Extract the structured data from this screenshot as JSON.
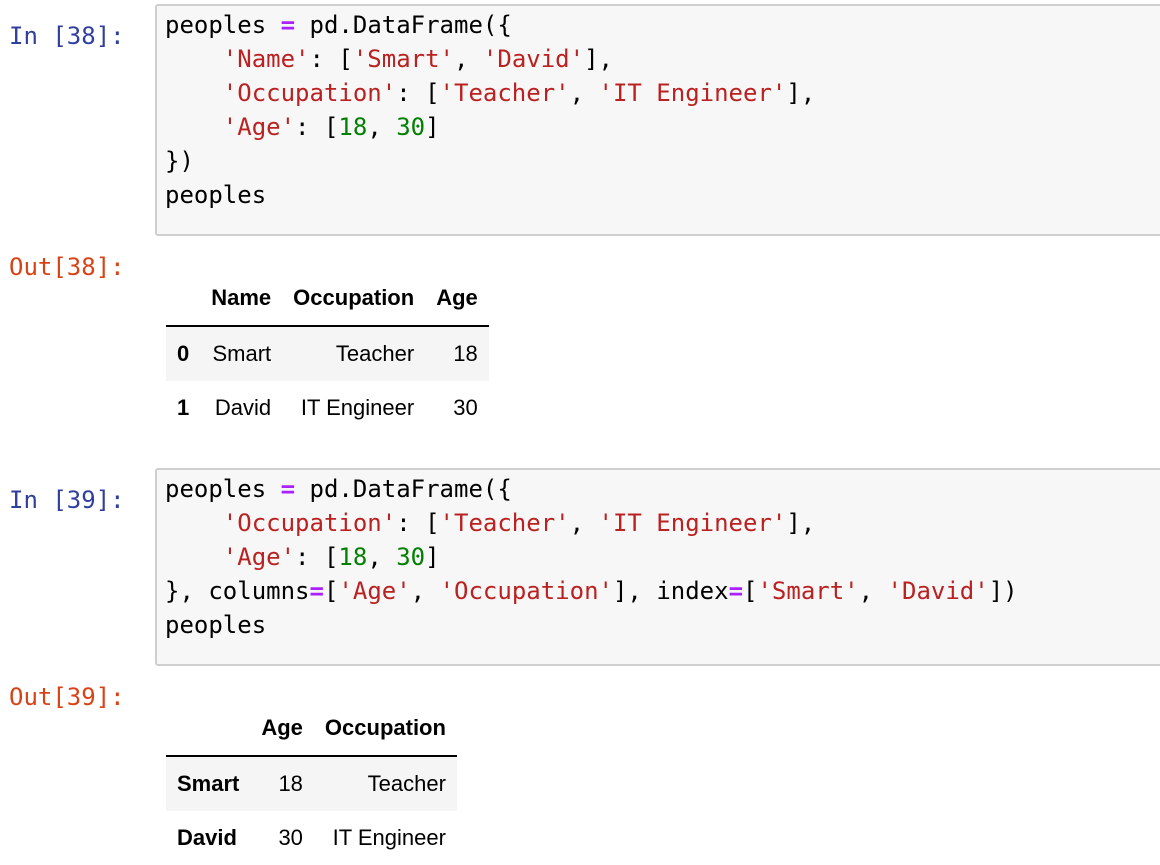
{
  "cells": [
    {
      "in_prompt": "In [38]:",
      "out_prompt": "Out[38]:",
      "code": {
        "var": "peoples",
        "eq": "=",
        "call": "pd.DataFrame({",
        "name_key": "'Name'",
        "colon": ":",
        "open_br": "[",
        "close_br": "],",
        "comma": ",",
        "name_v1": "'Smart'",
        "name_v2": "'David'",
        "occ_key": "'Occupation'",
        "occ_v1": "'Teacher'",
        "occ_v2": "'IT Engineer'",
        "age_key": "'Age'",
        "age_v1": "18",
        "age_v2": "30",
        "close_br_last": "]",
        "close_call": "})",
        "last_line": "peoples"
      },
      "table": {
        "header": [
          "",
          "Name",
          "Occupation",
          "Age"
        ],
        "rows": [
          {
            "index": "0",
            "cells": [
              "Smart",
              "Teacher",
              "18"
            ]
          },
          {
            "index": "1",
            "cells": [
              "David",
              "IT Engineer",
              "30"
            ]
          }
        ]
      }
    },
    {
      "in_prompt": "In [39]:",
      "out_prompt": "Out[39]:",
      "code": {
        "var": "peoples",
        "eq": "=",
        "call": "pd.DataFrame({",
        "occ_key": "'Occupation'",
        "colon": ":",
        "open_br": "[",
        "close_br": "],",
        "comma": ",",
        "occ_v1": "'Teacher'",
        "occ_v2": "'IT Engineer'",
        "age_key": "'Age'",
        "age_v1": "18",
        "age_v2": "30",
        "close_br_last": "]",
        "close_dict": "},",
        "columns_kw": "columns",
        "cols_v1": "'Age'",
        "cols_v2": "'Occupation'",
        "index_kw": "index",
        "idx_v1": "'Smart'",
        "idx_v2": "'David'",
        "close_end": "])",
        "last_line": "peoples"
      },
      "table": {
        "header": [
          "",
          "Age",
          "Occupation"
        ],
        "rows": [
          {
            "index": "Smart",
            "cells": [
              "18",
              "Teacher"
            ]
          },
          {
            "index": "David",
            "cells": [
              "30",
              "IT Engineer"
            ]
          }
        ]
      }
    }
  ]
}
